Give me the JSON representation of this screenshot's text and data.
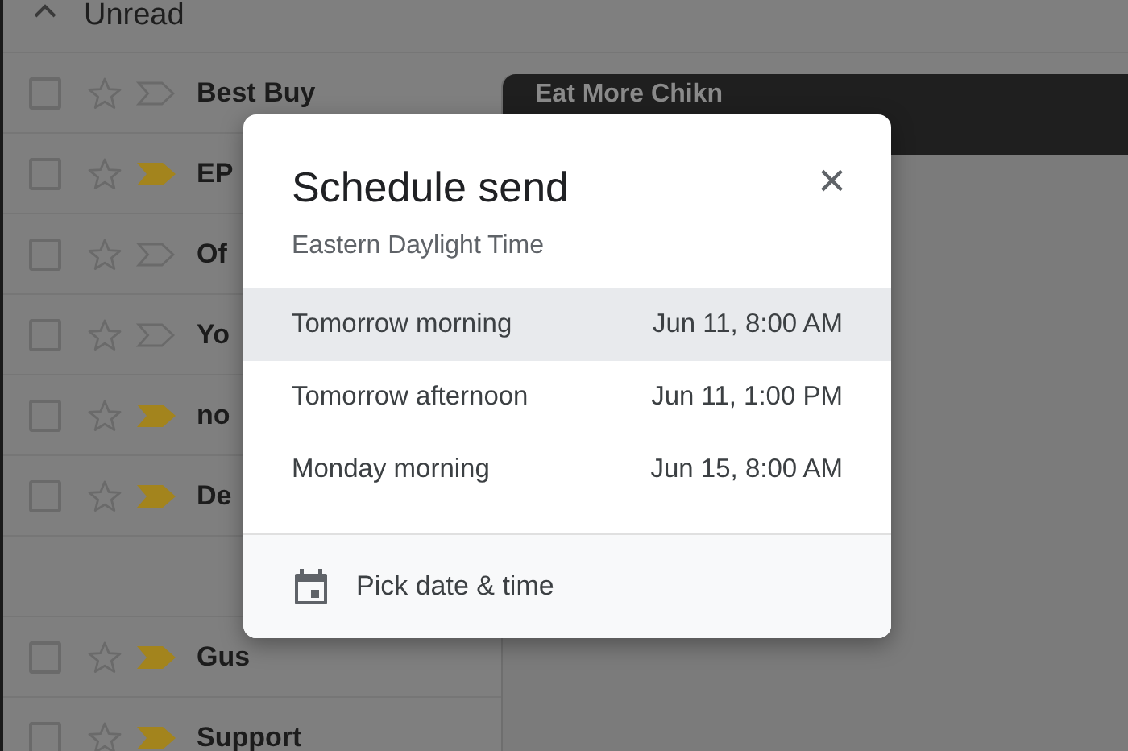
{
  "section": {
    "label": "Unread",
    "expanded": true
  },
  "emails": [
    {
      "sender": "Best Buy",
      "checked": false,
      "starred": false,
      "important": false
    },
    {
      "sender": "EP",
      "checked": false,
      "starred": false,
      "important": true
    },
    {
      "sender": "Of",
      "checked": false,
      "starred": false,
      "important": false
    },
    {
      "sender": "Yo",
      "checked": false,
      "starred": false,
      "important": false
    },
    {
      "sender": "no",
      "checked": false,
      "starred": false,
      "important": true
    },
    {
      "sender": "De",
      "checked": false,
      "starred": false,
      "important": true
    },
    {
      "kind": "blank"
    },
    {
      "sender": "Gus",
      "checked": false,
      "starred": false,
      "important": true
    },
    {
      "sender": "Support",
      "checked": false,
      "starred": false,
      "important": true
    }
  ],
  "compose": {
    "title": "Eat More Chikn"
  },
  "dialog": {
    "title": "Schedule send",
    "close": "×",
    "timezone": "Eastern Daylight Time",
    "options": [
      {
        "label": "Tomorrow morning",
        "time": "Jun 11, 8:00 AM",
        "selected": true
      },
      {
        "label": "Tomorrow afternoon",
        "time": "Jun 11, 1:00 PM",
        "selected": false
      },
      {
        "label": "Monday morning",
        "time": "Jun 15, 8:00 AM",
        "selected": false
      }
    ],
    "custom": "Pick date & time"
  }
}
